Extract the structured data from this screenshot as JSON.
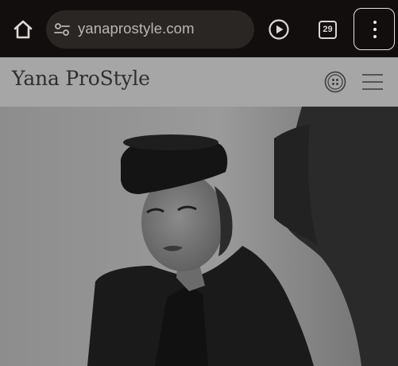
{
  "browser": {
    "url": "yanaprostyle.com",
    "tab_count": "29",
    "icons": {
      "home": "home-icon",
      "site_settings": "tune-icon",
      "play": "play-circle-icon",
      "tabs": "tab-switcher-icon",
      "menu": "more-vert-icon"
    }
  },
  "site": {
    "brand": "Yana ProStyle",
    "icons": {
      "language": "globe-button-icon",
      "menu": "hamburger-icon"
    }
  },
  "hero": {
    "image": "black-and-white portrait of a woman in a black hat and black blazer"
  },
  "colors": {
    "chrome_bg": "#120e0d",
    "url_bar_bg": "#2a2624",
    "site_header_bg": "#a6a6a6"
  }
}
